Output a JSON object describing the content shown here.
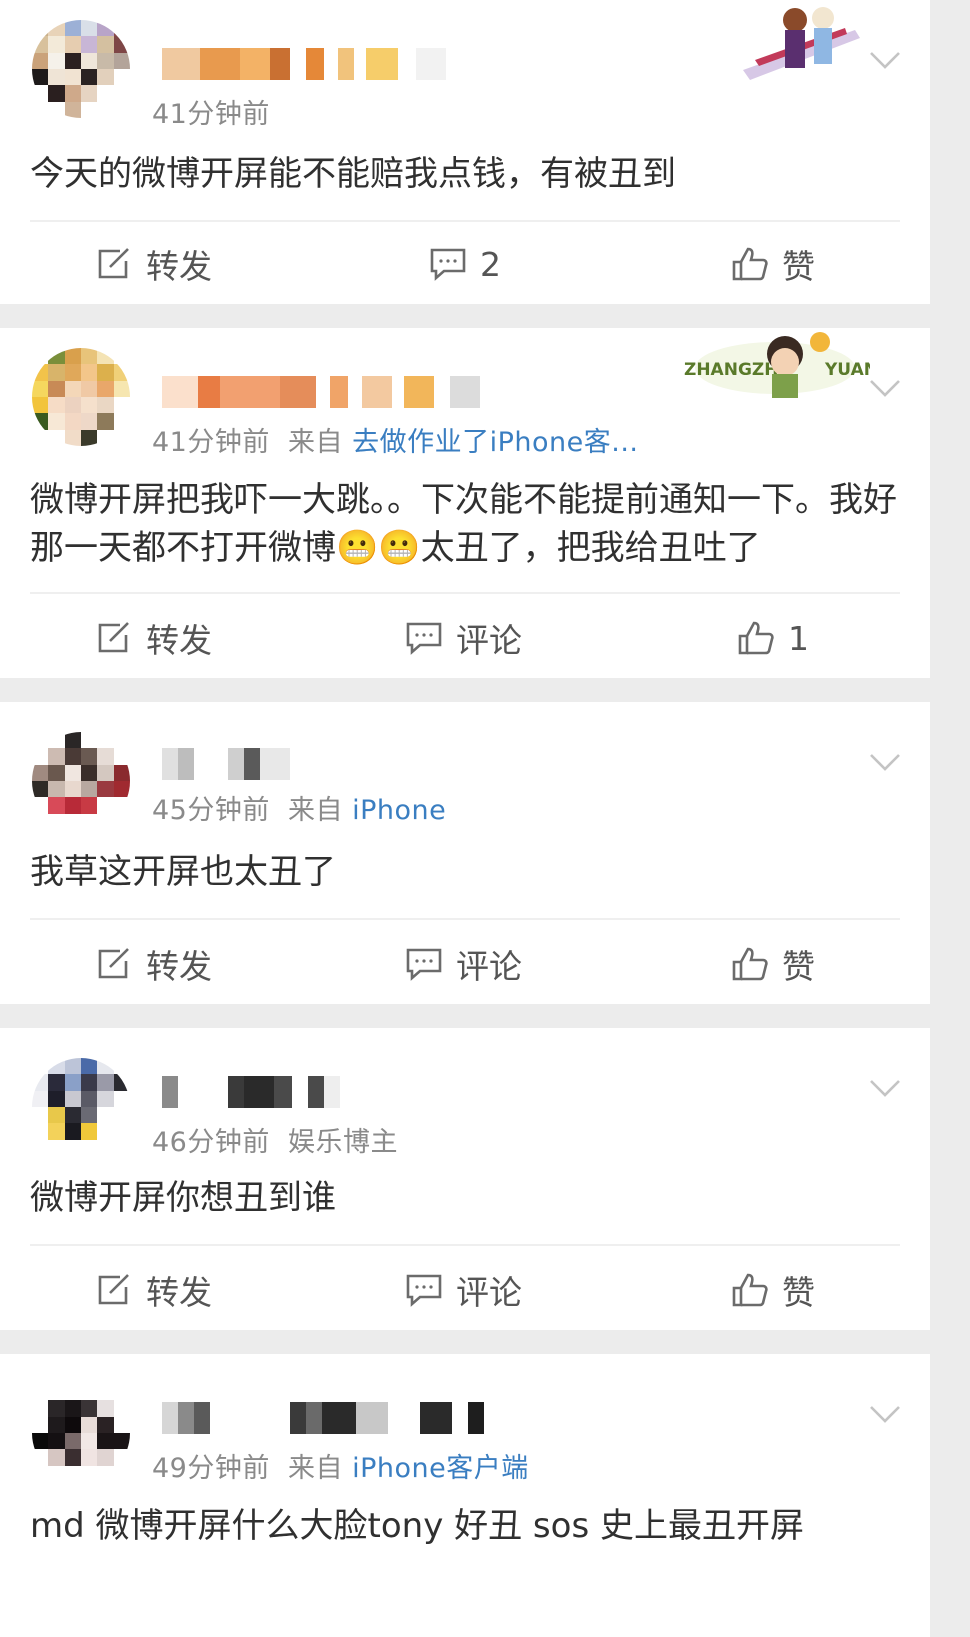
{
  "posts": [
    {
      "time": "41分钟前",
      "source_prefix": "",
      "source": "",
      "content": "今天的微博开屏能不能赔我点钱，有被丑到",
      "actions": {
        "repost": "转发",
        "comment": "2",
        "like": "赞"
      }
    },
    {
      "time": "41分钟前",
      "source_prefix": "来自",
      "source": "去做作业了iPhone客...",
      "content": "微博开屏把我吓一大跳。。下次能不能提前通知一下。我好那一天都不打开微博😬😬太丑了，把我给丑吐了",
      "badge_text_left": "ZHANGZHE",
      "badge_text_right": "YUAN",
      "actions": {
        "repost": "转发",
        "comment": "评论",
        "like": "1"
      }
    },
    {
      "time": "45分钟前",
      "source_prefix": "来自",
      "source": "iPhone",
      "content": "我草这开屏也太丑了",
      "actions": {
        "repost": "转发",
        "comment": "评论",
        "like": "赞"
      }
    },
    {
      "time": "46分钟前",
      "source_prefix": "娱乐博主",
      "source": "",
      "content": "微博开屏你想丑到谁",
      "actions": {
        "repost": "转发",
        "comment": "评论",
        "like": "赞"
      }
    },
    {
      "time": "49分钟前",
      "source_prefix": "来自",
      "source": "iPhone客户端",
      "content": "md 微博开屏什么大脸tony 好丑 sos 史上最丑开屏"
    }
  ],
  "colors": {
    "link": "#3a7ec1",
    "meta": "#8a8a8a",
    "bg": "#ececec"
  }
}
